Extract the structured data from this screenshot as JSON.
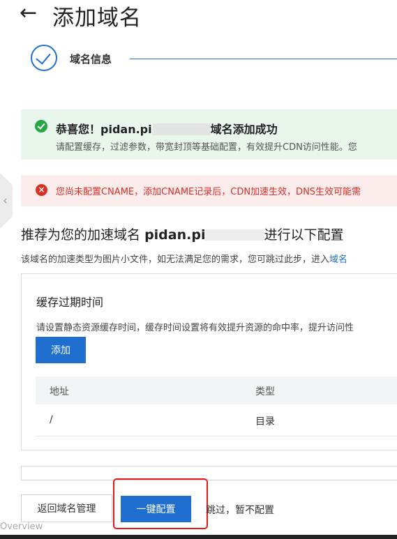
{
  "header": {
    "back_icon": "←",
    "title": "添加域名"
  },
  "stepper": {
    "step_label": "域名信息",
    "accent": "#1f6fd1"
  },
  "alerts": {
    "success": {
      "prefix": "恭喜您！pidan.pi",
      "suffix": "域名添加成功",
      "description": "请配置缓存，过滤参数，带宽封顶等基础配置，有效提升CDN访问性能。您",
      "color": "#27a744"
    },
    "error": {
      "icon": "×",
      "text": "您尚未配置CNAME，添加CNAME记录后，CDN加速生效，DNS生效可能需",
      "color": "#d93026"
    }
  },
  "recommend": {
    "title_prefix": "推荐为您的加速域名",
    "domain_prefix": "pidan.pi",
    "title_suffix": "进行以下配置",
    "description": "该域名的加速类型为图片小文件，如无法满足您的需求，您可跳过此步，进入",
    "link_text": "域名"
  },
  "cache_panel": {
    "title": "缓存过期时间",
    "description": "请设置静态资源缓存时间，缓存时间设置将有效提升资源的命中率，提升访问性",
    "add_label": "添加",
    "columns": [
      "地址",
      "类型"
    ],
    "rows": [
      {
        "address": "/",
        "type": "目录"
      }
    ]
  },
  "footer": {
    "back_label": "返回域名管理",
    "oneclick_label": "一键配置",
    "skip_label": "跳过，暂不配置",
    "overview_label": "Overview"
  },
  "edge_chevron": "‹"
}
